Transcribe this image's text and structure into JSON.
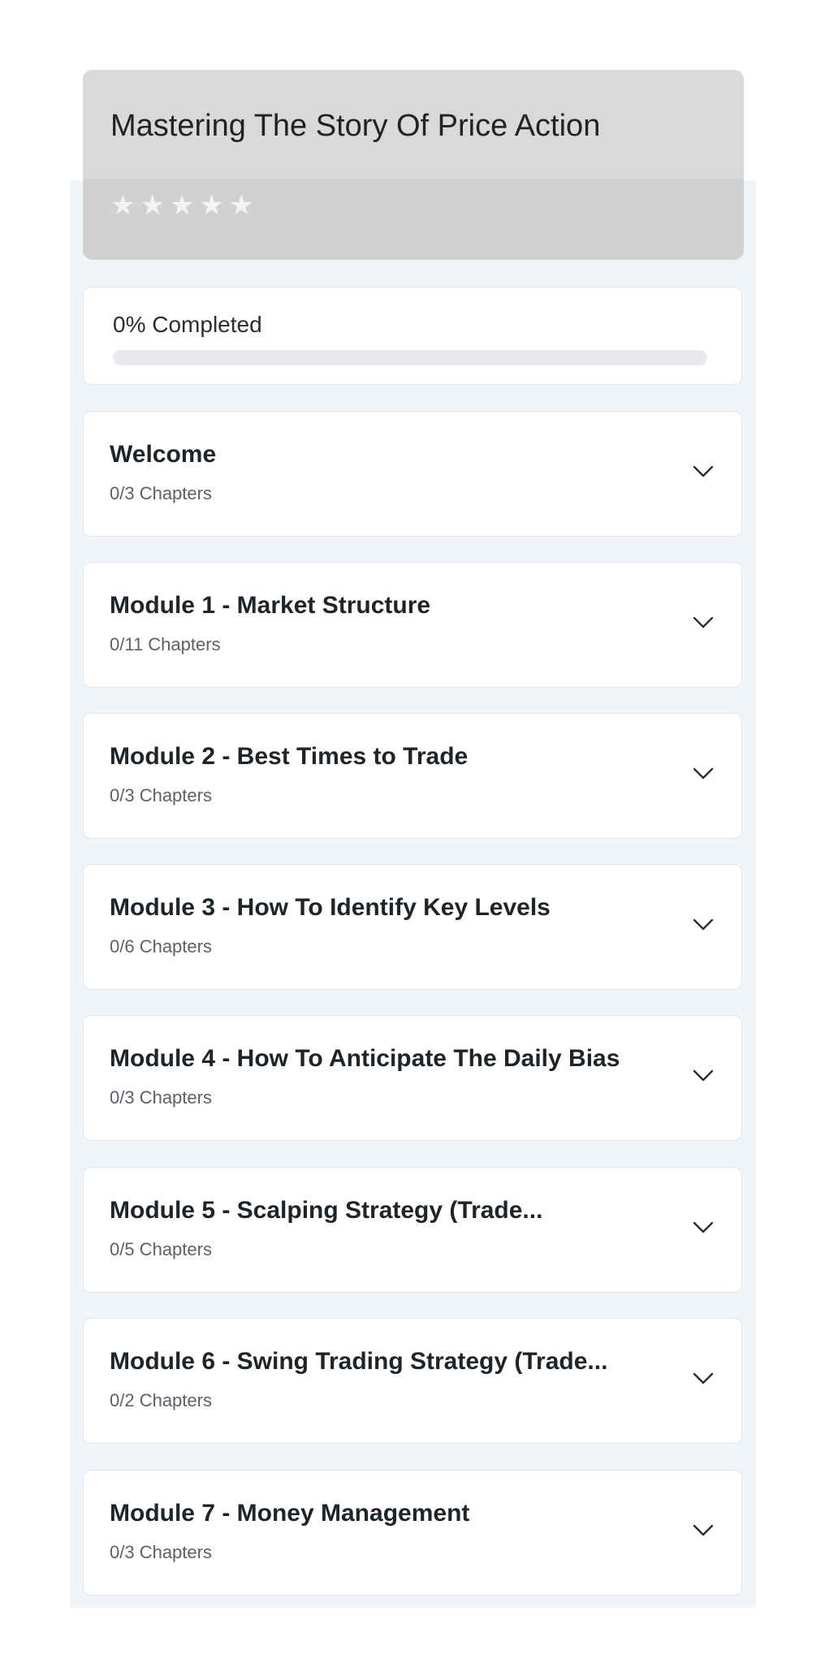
{
  "course": {
    "title": "Mastering The Story Of Price Action",
    "rating_stars": 5,
    "rating_filled": 0
  },
  "progress": {
    "label": "0% Completed",
    "fraction": 0
  },
  "modules": [
    {
      "title": "Welcome",
      "chapters": "0/3 Chapters"
    },
    {
      "title": "Module 1 - Market Structure",
      "chapters": "0/11 Chapters"
    },
    {
      "title": "Module 2 - Best Times to Trade",
      "chapters": "0/3 Chapters"
    },
    {
      "title": "Module 3 - How To Identify Key Levels",
      "chapters": "0/6 Chapters"
    },
    {
      "title": "Module 4 - How To Anticipate The Daily Bias",
      "chapters": "0/3 Chapters"
    },
    {
      "title": "Module 5 - Scalping Strategy (Trade...",
      "chapters": "0/5 Chapters"
    },
    {
      "title": "Module 6 - Swing Trading Strategy (Trade...",
      "chapters": "0/2 Chapters"
    },
    {
      "title": "Module 7 - Money Management",
      "chapters": "0/3 Chapters"
    }
  ],
  "icons": {
    "star": "star-icon",
    "expand": "chevron-down-icon"
  },
  "colors": {
    "panel_bg": "#f1f4f8",
    "header_bg": "#d9d9d7",
    "star": "#f2f3f4",
    "progress_track": "#e8eaed"
  }
}
